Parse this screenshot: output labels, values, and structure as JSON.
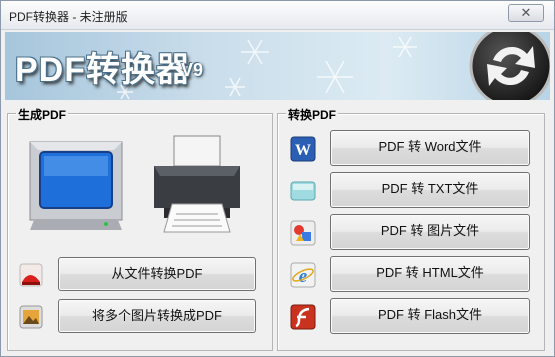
{
  "window": {
    "title": "PDF转换器 - 未注册版",
    "close_label": "✕"
  },
  "banner": {
    "title": "PDF转换器",
    "version": "V9"
  },
  "generate_group": {
    "label": "生成PDF",
    "buttons": [
      {
        "label": "从文件转换PDF",
        "icon": "pdf-file-icon"
      },
      {
        "label": "将多个图片转换成PDF",
        "icon": "image-file-icon"
      }
    ]
  },
  "convert_group": {
    "label": "转换PDF",
    "buttons": [
      {
        "label": "PDF 转 Word文件",
        "icon": "word-icon"
      },
      {
        "label": "PDF 转 TXT文件",
        "icon": "txt-icon"
      },
      {
        "label": "PDF 转 图片文件",
        "icon": "image-icon"
      },
      {
        "label": "PDF 转 HTML文件",
        "icon": "html-icon"
      },
      {
        "label": "PDF 转 Flash文件",
        "icon": "flash-icon"
      }
    ]
  },
  "colors": {
    "accent_blue": "#1e6fd9",
    "word_blue": "#2b5fb4",
    "flash_red": "#c8321e",
    "pdf_red": "#d8201c"
  }
}
